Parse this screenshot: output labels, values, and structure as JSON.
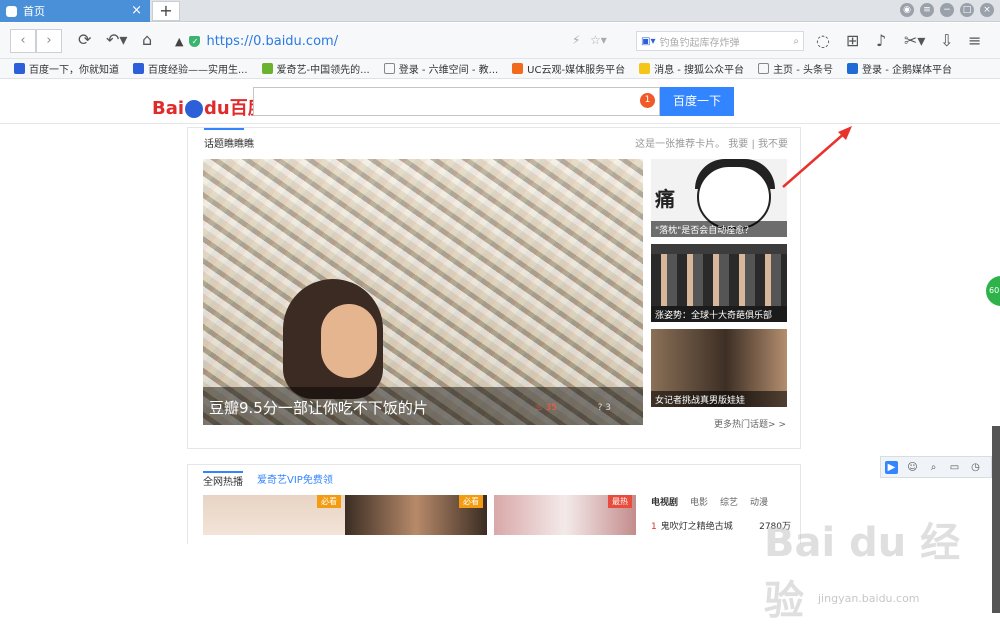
{
  "tab": {
    "title": "首页",
    "close": "×",
    "new": "+"
  },
  "address": {
    "url": "https://0.baidu.com/",
    "search_placeholder": "钓鱼钓起库存炸弹"
  },
  "bookmarks": [
    "百度一下，你就知道",
    "百度经验——实用生...",
    "爱奇艺-中国领先的...",
    "登录 - 六维空间 - 教...",
    "UC云观-媒体服务平台",
    "消息 - 搜狐公众平台",
    "主页 - 头条号",
    "登录 - 企鹅媒体平台"
  ],
  "baidu": {
    "logo_bai": "Bai",
    "logo_du": "du",
    "logo_cn": "百度",
    "button": "百度一下",
    "badge": "1"
  },
  "card": {
    "title": "话题瞧瞧瞧",
    "right": "这是一张推荐卡片。   我要  |  我不要",
    "hero_caption": "豆瓣9.5分一部让你吃不下饭的片",
    "hero_likes": "35",
    "hero_comments": "3",
    "side_captions": [
      "\"落枕\"是否会自动痊愈？",
      "涨姿势：全球十大奇葩俱乐部",
      "女记者挑战真男版娃娃"
    ],
    "side_char": "痛",
    "more": "更多热门话题> >"
  },
  "card2": {
    "tabs": [
      "全网热播",
      "爱奇艺VIP免费领"
    ],
    "ribbons": [
      "必看",
      "必看",
      "最热"
    ],
    "tv_tabs": [
      "电视剧",
      "电影",
      "综艺",
      "动漫"
    ],
    "tv_row": {
      "rank": "1",
      "name": "鬼吹灯之精绝古城",
      "count": "2780万"
    }
  },
  "green_badge": "60",
  "watermark": {
    "big": "Bai du 经验",
    "small": "jingyan.baidu.com"
  }
}
